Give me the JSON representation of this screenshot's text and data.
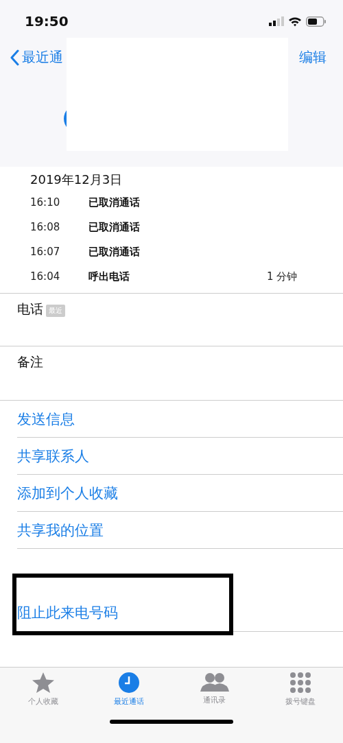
{
  "status_bar": {
    "time": "19:50"
  },
  "nav": {
    "back": "最近通",
    "edit": "编辑"
  },
  "call_log": {
    "date": "2019年12月3日",
    "calls": [
      {
        "time": "16:10",
        "type": "已取消通话"
      },
      {
        "time": "16:08",
        "type": "已取消通话"
      },
      {
        "time": "16:07",
        "type": "已取消通话"
      },
      {
        "time": "16:04",
        "type": "呼出电话",
        "duration": "1 分钟"
      }
    ]
  },
  "phone": {
    "label": "电话",
    "badge": "最近"
  },
  "notes": {
    "label": "备注"
  },
  "actions": [
    {
      "label": "发送信息"
    },
    {
      "label": "共享联系人"
    },
    {
      "label": "添加到个人收藏"
    },
    {
      "label": "共享我的位置"
    }
  ],
  "block": {
    "label": "阻止此来电号码",
    "highlighted": true
  },
  "tab_bar": [
    {
      "label": "个人收藏",
      "kind": "star",
      "selected": false
    },
    {
      "label": "最近通话",
      "kind": "clock",
      "selected": true
    },
    {
      "label": "通讯录",
      "kind": "people",
      "selected": false
    },
    {
      "label": "拨号键盘",
      "kind": "keypad",
      "selected": false
    }
  ]
}
